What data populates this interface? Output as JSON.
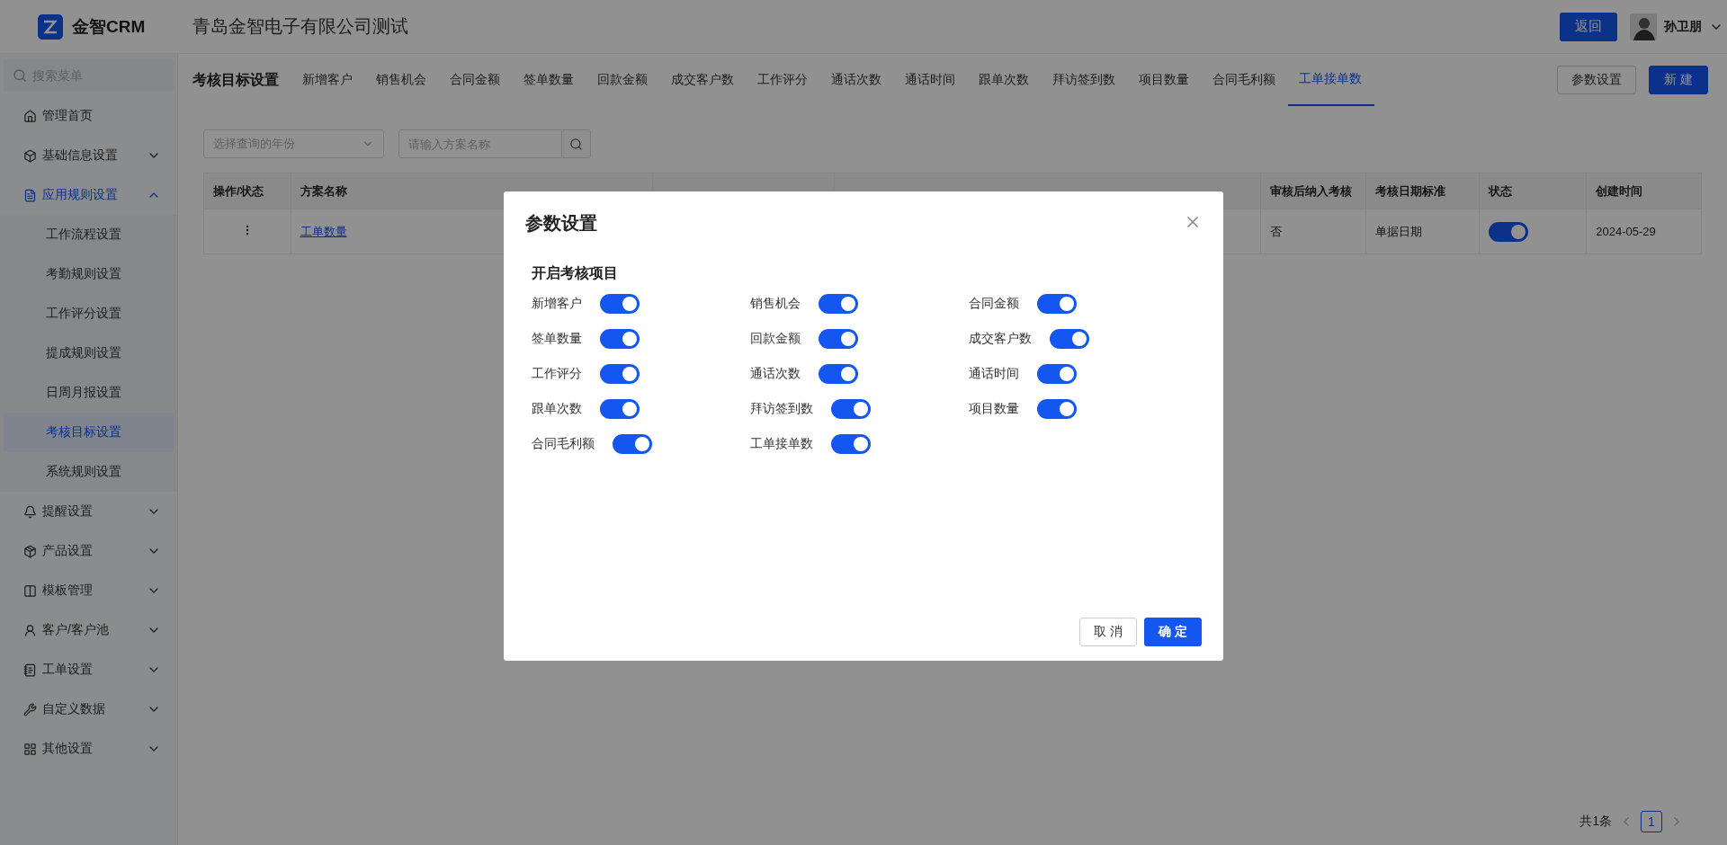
{
  "header": {
    "brand": "金智CRM",
    "company": "青岛金智电子有限公司测试",
    "back_button": "返回",
    "user_name": "孙卫朋"
  },
  "sidebar": {
    "search_placeholder": "搜索菜单",
    "items": [
      {
        "label": "管理首页",
        "selected": false
      },
      {
        "label": "基础信息设置",
        "selected": false,
        "expanded": false
      },
      {
        "label": "应用规则设置",
        "selected": false,
        "expanded": true,
        "children": [
          {
            "label": "工作流程设置",
            "selected": false
          },
          {
            "label": "考勤规则设置",
            "selected": false
          },
          {
            "label": "工作评分设置",
            "selected": false
          },
          {
            "label": "提成规则设置",
            "selected": false
          },
          {
            "label": "日周月报设置",
            "selected": false
          },
          {
            "label": "考核目标设置",
            "selected": true
          },
          {
            "label": "系统规则设置",
            "selected": false
          }
        ]
      },
      {
        "label": "提醒设置",
        "selected": false,
        "expanded": false
      },
      {
        "label": "产品设置",
        "selected": false,
        "expanded": false
      },
      {
        "label": "模板管理",
        "selected": false,
        "expanded": false
      },
      {
        "label": "客户/客户池",
        "selected": false,
        "expanded": false
      },
      {
        "label": "工单设置",
        "selected": false,
        "expanded": false
      },
      {
        "label": "自定义数据",
        "selected": false,
        "expanded": false
      },
      {
        "label": "其他设置",
        "selected": false,
        "expanded": false
      }
    ]
  },
  "page_title": "考核目标设置",
  "tabs": [
    {
      "label": "新增客户",
      "selected": false
    },
    {
      "label": "销售机会",
      "selected": false
    },
    {
      "label": "合同金额",
      "selected": false
    },
    {
      "label": "签单数量",
      "selected": false
    },
    {
      "label": "回款金额",
      "selected": false
    },
    {
      "label": "成交客户数",
      "selected": false
    },
    {
      "label": "工作评分",
      "selected": false
    },
    {
      "label": "通话次数",
      "selected": false
    },
    {
      "label": "通话时间",
      "selected": false
    },
    {
      "label": "跟单次数",
      "selected": false
    },
    {
      "label": "拜访签到数",
      "selected": false
    },
    {
      "label": "项目数量",
      "selected": false
    },
    {
      "label": "合同毛利额",
      "selected": false
    },
    {
      "label": "工单接单数",
      "selected": true
    }
  ],
  "toolbar_buttons": [
    "参数设置",
    "新 建"
  ],
  "filters": {
    "year_placeholder": "选择查询的年份",
    "name_placeholder": "请输入方案名称"
  },
  "table": {
    "columns": [
      "操作/状态",
      "方案名称",
      "审核后纳入考核",
      "考核日期标准",
      "状态",
      "创建时间"
    ],
    "rows": [
      {
        "name": "工单数量",
        "include_after_review": "否",
        "date_standard": "单据日期",
        "status_on": true,
        "created": "2024-05-29"
      }
    ]
  },
  "pagination": {
    "total": "共1条",
    "pages": [
      {
        "label": "1",
        "selected": true
      }
    ]
  },
  "dialog": {
    "title": "参数设置",
    "section": "开启考核项目",
    "items": [
      {
        "label": "新增客户",
        "on": true
      },
      {
        "label": "销售机会",
        "on": true
      },
      {
        "label": "合同金额",
        "on": true
      },
      {
        "label": "签单数量",
        "on": true
      },
      {
        "label": "回款金额",
        "on": true
      },
      {
        "label": "成交客户数",
        "on": true
      },
      {
        "label": "工作评分",
        "on": true
      },
      {
        "label": "通话次数",
        "on": true
      },
      {
        "label": "通话时间",
        "on": true
      },
      {
        "label": "跟单次数",
        "on": true
      },
      {
        "label": "拜访签到数",
        "on": true
      },
      {
        "label": "项目数量",
        "on": true
      },
      {
        "label": "合同毛利额",
        "on": true
      },
      {
        "label": "工单接单数",
        "on": true
      }
    ],
    "cancel": "取 消",
    "confirm": "确 定"
  }
}
